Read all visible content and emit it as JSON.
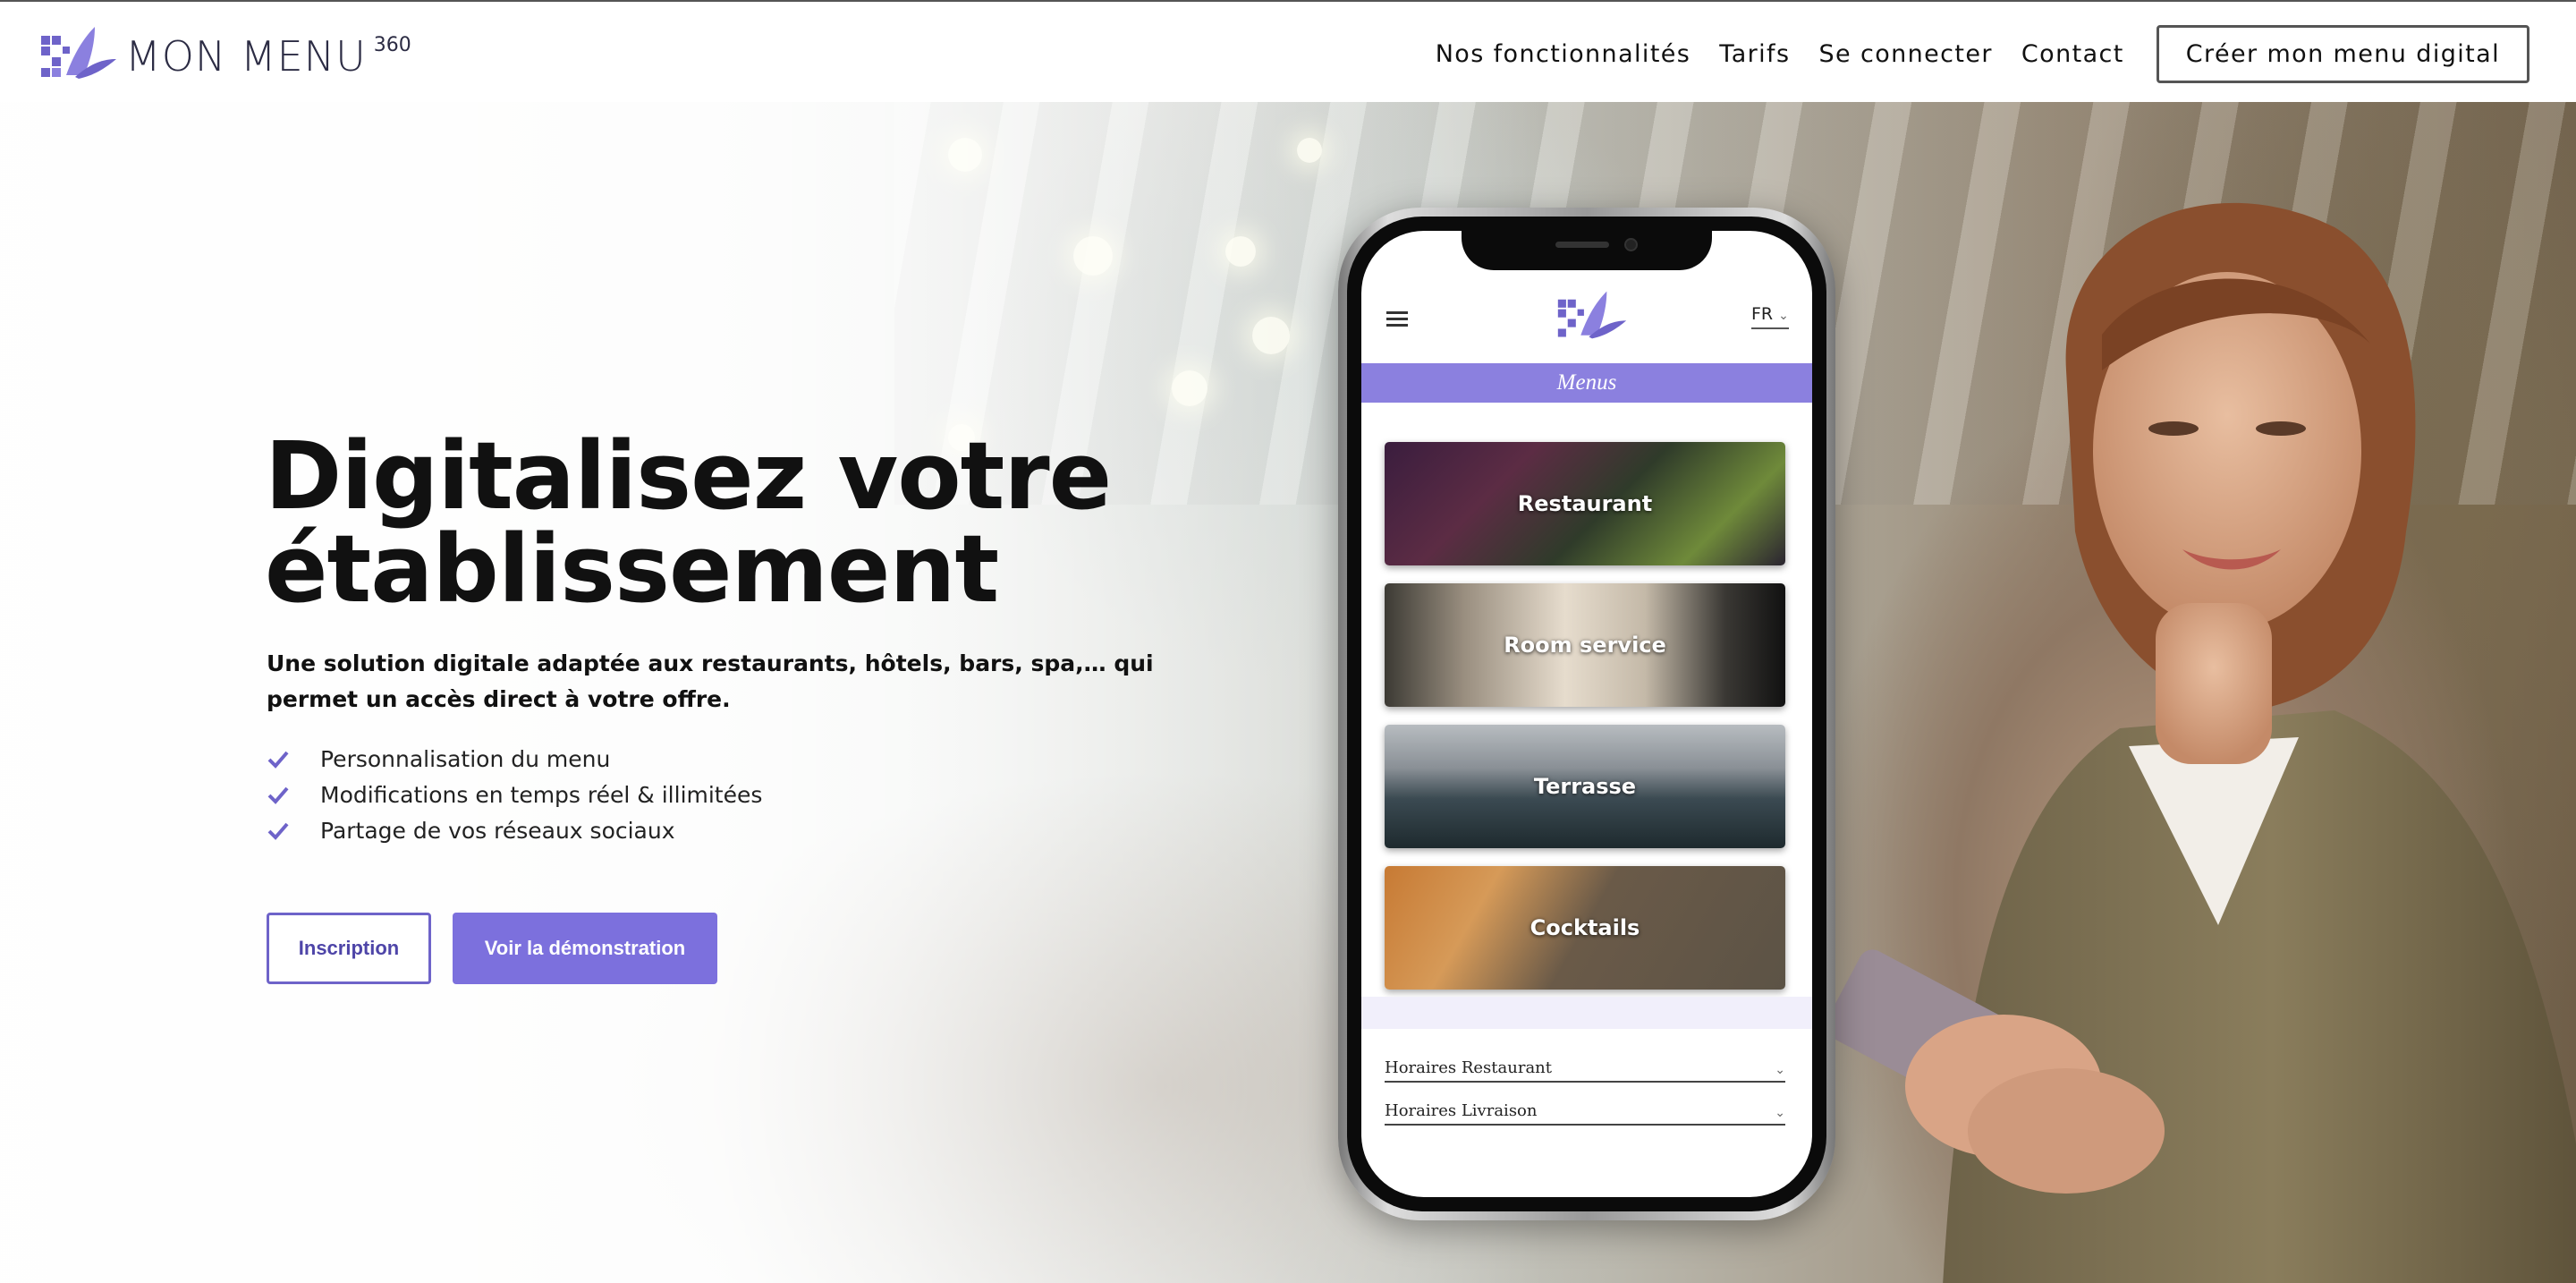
{
  "brand": {
    "name": "MON MENU",
    "superscript": "360",
    "accent_color": "#7c70dd"
  },
  "nav": {
    "links": [
      "Nos fonctionnalités",
      "Tarifs",
      "Se connecter",
      "Contact"
    ],
    "cta_label": "Créer mon menu digital"
  },
  "hero": {
    "title_line1": "Digitalisez votre",
    "title_line2": "établissement",
    "subtitle": "Une solution digitale adaptée aux restaurants, hôtels, bars, spa,… qui permet un accès direct à votre offre.",
    "features": [
      "Personnalisation du menu",
      "Modifications en temps réel & illimitées",
      "Partage de vos réseaux sociaux"
    ],
    "button_primary_label": "Inscription",
    "button_secondary_label": "Voir la démonstration"
  },
  "phone": {
    "language": "FR",
    "section_title": "Menus",
    "cards": [
      "Restaurant",
      "Room service",
      "Terrasse",
      "Cocktails"
    ],
    "accordions": [
      "Horaires Restaurant",
      "Horaires Livraison"
    ]
  }
}
